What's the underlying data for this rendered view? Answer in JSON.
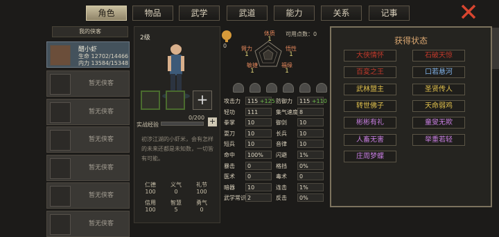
{
  "tabs": [
    {
      "label": "角色",
      "active": true
    },
    {
      "label": "物品"
    },
    {
      "label": "武学"
    },
    {
      "label": "武道"
    },
    {
      "label": "能力"
    },
    {
      "label": "关系"
    },
    {
      "label": "记事"
    }
  ],
  "left": {
    "header": "我的侠客",
    "selected": {
      "name": "醋小虾",
      "hp_label": "生命",
      "hp": "12702/14466",
      "mp_label": "内力",
      "mp": "13584/15348"
    },
    "empty_label": "暂无侠客"
  },
  "center": {
    "level": "2级",
    "exp_label": "实战经验",
    "exp_value": "0/200",
    "exp_progress": 0,
    "description": "初涉江湖的小虾米，会有怎样的未来还都是未知数，一切皆有可能。",
    "plus_label": "+",
    "virtues": [
      {
        "name": "仁德",
        "value": "100"
      },
      {
        "name": "义气",
        "value": "0"
      },
      {
        "name": "礼节",
        "value": "100"
      },
      {
        "name": "信用",
        "value": "100"
      },
      {
        "name": "智慧",
        "value": "5"
      },
      {
        "name": "勇气",
        "value": "0"
      }
    ]
  },
  "middle": {
    "points_label": "可用点数：",
    "points": "0",
    "icon_value": "0",
    "radar": [
      {
        "name": "体质",
        "value": "1"
      },
      {
        "name": "悟性",
        "value": "1"
      },
      {
        "name": "福缘",
        "value": "1"
      },
      {
        "name": "敏捷",
        "value": "1"
      },
      {
        "name": "臂力",
        "value": "1"
      }
    ],
    "stats": [
      {
        "k": "攻击力",
        "v": "115",
        "bonus": "+125"
      },
      {
        "k": "防御力",
        "v": "115",
        "bonus": "+110"
      },
      {
        "k": "轻功",
        "v": "111"
      },
      {
        "k": "集气速度",
        "v": "8"
      },
      {
        "k": "拳掌",
        "v": "10"
      },
      {
        "k": "御剑",
        "v": "10"
      },
      {
        "k": "耍刀",
        "v": "10"
      },
      {
        "k": "长兵",
        "v": "10"
      },
      {
        "k": "短兵",
        "v": "10"
      },
      {
        "k": "音律",
        "v": "10"
      },
      {
        "k": "命中",
        "v": "100%"
      },
      {
        "k": "闪避",
        "v": "1%"
      },
      {
        "k": "暴击",
        "v": "0"
      },
      {
        "k": "格挡",
        "v": "0%"
      },
      {
        "k": "医术",
        "v": "0"
      },
      {
        "k": "毒术",
        "v": "0"
      },
      {
        "k": "暗器",
        "v": "10"
      },
      {
        "k": "连击",
        "v": "1%"
      },
      {
        "k": "武学常识",
        "v": "2"
      },
      {
        "k": "反击",
        "v": "0%"
      }
    ]
  },
  "right": {
    "title": "获得状态",
    "tags": [
      {
        "label": "大侠情怀",
        "color": "#c0392b"
      },
      {
        "label": "石破天惊",
        "color": "#c0392b"
      },
      {
        "label": "百変之王",
        "color": "#c0392b"
      },
      {
        "label": "口若悬河",
        "color": "#7fb0e6"
      },
      {
        "label": "武林盟主",
        "color": "#e0c04c"
      },
      {
        "label": "圣贤传人",
        "color": "#e0c04c"
      },
      {
        "label": "转世佛子",
        "color": "#e0c04c"
      },
      {
        "label": "天命弱鸡",
        "color": "#e0c04c"
      },
      {
        "label": "彬彬有礼",
        "color": "#c77ee0"
      },
      {
        "label": "童叟无欺",
        "color": "#c77ee0"
      },
      {
        "label": "人畜无害",
        "color": "#c77ee0"
      },
      {
        "label": "举重若轻",
        "color": "#c77ee0"
      },
      {
        "label": "庄周梦蝶",
        "color": "#c77ee0"
      }
    ]
  }
}
